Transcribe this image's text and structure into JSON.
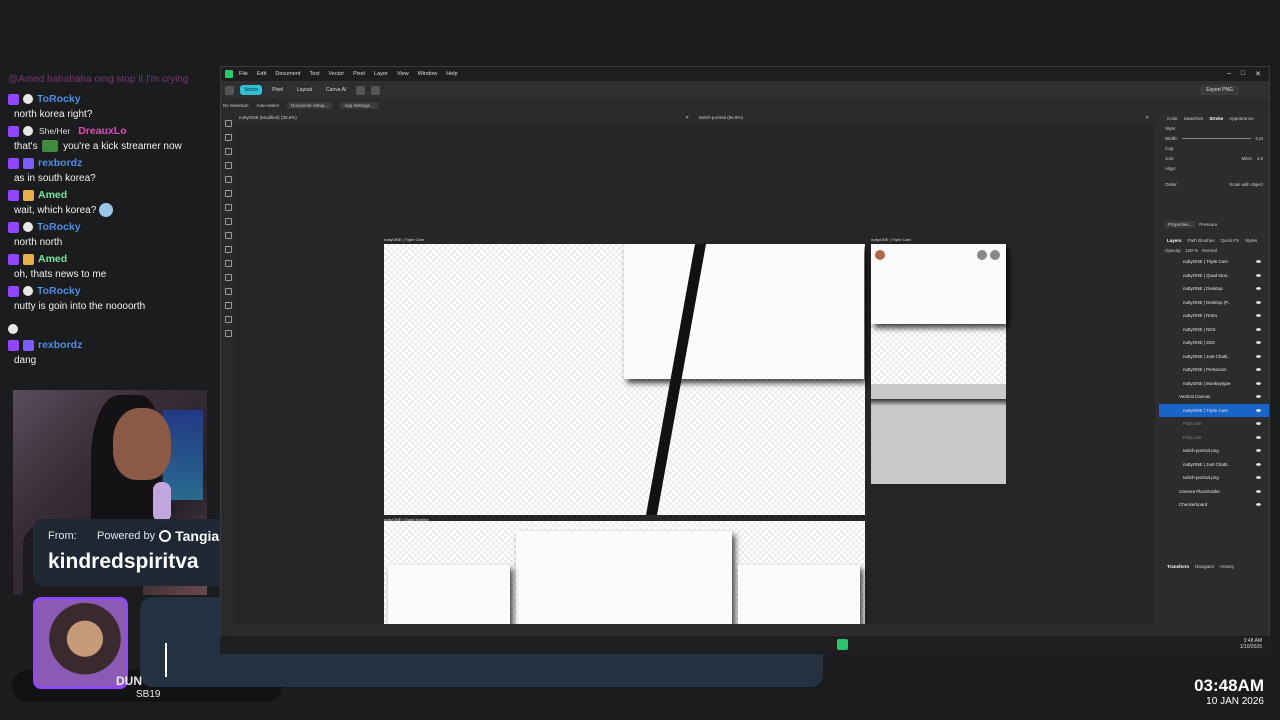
{
  "chat": {
    "faded_line": "@Amed hahahaha omg stop it I'm crying",
    "messages": [
      {
        "user": "ToRocky",
        "color": "#4c8dde",
        "text": "north korea right?"
      },
      {
        "user": "DreauxLo",
        "color": "#d94fb5",
        "pronoun": "She/Her",
        "text": "that's you're a kick streamer now",
        "text_a": "that's",
        "text_b": "you're a kick streamer now"
      },
      {
        "user": "rexbordz",
        "color": "#4f8de0",
        "text": "as in south korea?"
      },
      {
        "user": "Amed",
        "color": "#7ae0a0",
        "text": "wait, which korea?"
      },
      {
        "user": "ToRocky",
        "color": "#4c8dde",
        "text": "north north"
      },
      {
        "user": "Amed",
        "color": "#7ae0a0",
        "text": "oh, thats news to me"
      },
      {
        "user": "ToRocky",
        "color": "#4c8dde",
        "text": "nutty is goin into the noooorth"
      },
      {
        "user": "rexbordz",
        "color": "#4f8de0",
        "text": "dang"
      }
    ]
  },
  "tip_alert": {
    "from_label": "From:",
    "powered_label": "Powered by",
    "brand": "Tangia",
    "name": "kindredspiritva"
  },
  "subscriber": {
    "name": "DUN",
    "badge_text": "SB19"
  },
  "clock": {
    "time": "03:48AM",
    "date": "10 JAN 2026"
  },
  "app": {
    "menu": [
      "File",
      "Edit",
      "Document",
      "Text",
      "Vector",
      "Pixel",
      "Layer",
      "View",
      "Window",
      "Help"
    ],
    "personas": [
      "Vector",
      "Pixel",
      "Layout",
      "Canva AI"
    ],
    "export_label": "Export PNG",
    "context": {
      "no_selection": "No Selection",
      "auto_select": "Auto-select",
      "doc_setup": "Document Setup...",
      "app_settings": "App Settings..."
    },
    "tabs": [
      {
        "title": "nuttyONE (Modified) (30.6%)"
      },
      {
        "title": "twitch-portrait (56.8%)"
      }
    ],
    "artboards": {
      "triple_cam": "nuttyONE | Triple Cam",
      "triple_cam_2": "nuttyONE | Triple Cam",
      "quad_monitor": "nuttyONE | Quad Monitor"
    },
    "right_panel": {
      "tabs": [
        "Color",
        "Swatches",
        "Stroke",
        "Appearance"
      ],
      "active_tab": "Stroke",
      "style_label": "Style:",
      "width_label": "Width:",
      "width_value": "0 pt",
      "cap_label": "Cap:",
      "join_label": "Join:",
      "mitre_label": "Mitre:",
      "mitre_value": "1.5",
      "align_label": "Align:",
      "order_label": "Order:",
      "scale_label": "Scale with object",
      "props_btn": "Properties...",
      "pressure_btn": "Pressure",
      "layer_tabs": [
        "Layers",
        "Path Brushes",
        "Quick FX",
        "Styles"
      ],
      "opacity_label": "Opacity:",
      "opacity_value": "100 %",
      "blend_value": "Normal",
      "layers": [
        "nuttyONE | Triple Cam",
        "nuttyONE | Quad Mon..",
        "nuttyONE | Desktop",
        "nuttyONE | Desktop (P..",
        "nuttyONE | Retro",
        "nuttyONE | NDS",
        "nuttyONE | 3DS",
        "nuttyONE | Just Chatti..",
        "nuttyONE | Pentacam",
        "nuttyONE | Monkeytype",
        "Vertical Canvas",
        "nuttyONE | Triple Cam",
        "Poly Line",
        "Poly Line",
        "twitch-portrait.png",
        "nuttyONE | Just Chatti..",
        "twitch-portrait.png",
        "Camera Placeholder",
        "Checkerboard"
      ],
      "selected_layer_index": 11,
      "bottom_tabs": [
        "Transform",
        "Navigator",
        "History"
      ]
    }
  },
  "taskbar": {
    "time": "3:48 AM",
    "date": "1/10/2026",
    "tray": "60"
  }
}
